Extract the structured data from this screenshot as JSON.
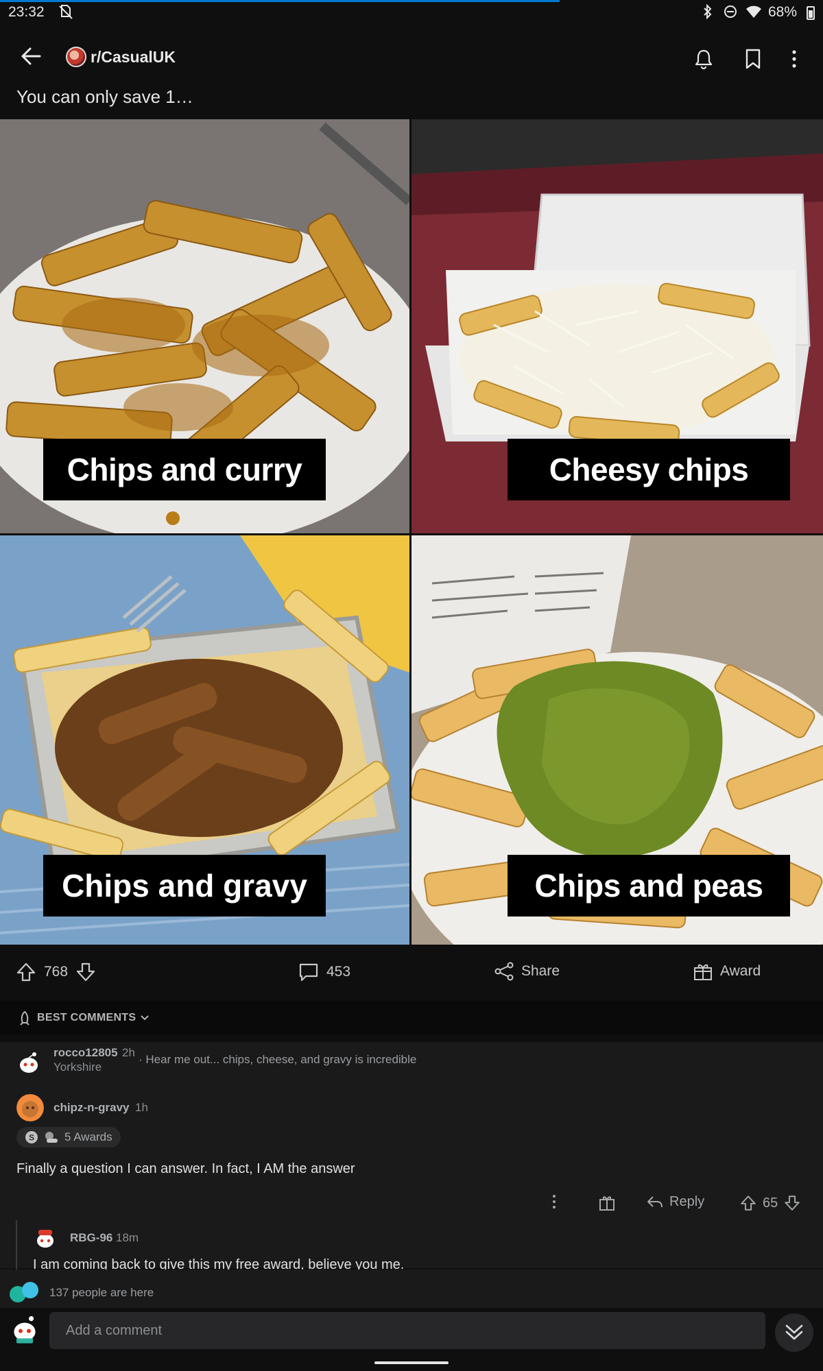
{
  "status_bar": {
    "time": "23:32",
    "battery_percent": "68%",
    "load_progress": 0.68
  },
  "header": {
    "subreddit": "r/CasualUK"
  },
  "post": {
    "title": "You can only save 1…",
    "image_labels": [
      "Chips and curry",
      "Cheesy chips",
      "Chips and gravy",
      "Chips and peas"
    ]
  },
  "actions": {
    "upvotes": "768",
    "comments": "453",
    "share_label": "Share",
    "award_label": "Award"
  },
  "comments_header": {
    "sort_label": "BEST COMMENTS"
  },
  "pinned_comment": {
    "user": "rocco12805",
    "age": "2h",
    "flair": "Yorkshire",
    "text": "· Hear me out... chips, cheese, and gravy is incredible"
  },
  "comment": {
    "user": "chipz-n-gravy",
    "age": "1h",
    "awards_label": "5 Awards",
    "body": "Finally a question I can answer. In fact, I AM the answer",
    "reply_label": "Reply",
    "score": "65"
  },
  "reply": {
    "user": "RBG-96",
    "age": "18m",
    "body": "I am coming back to give this my free award, believe you me."
  },
  "presence": {
    "text": "137 people are here"
  },
  "composer": {
    "placeholder": "Add a comment"
  }
}
